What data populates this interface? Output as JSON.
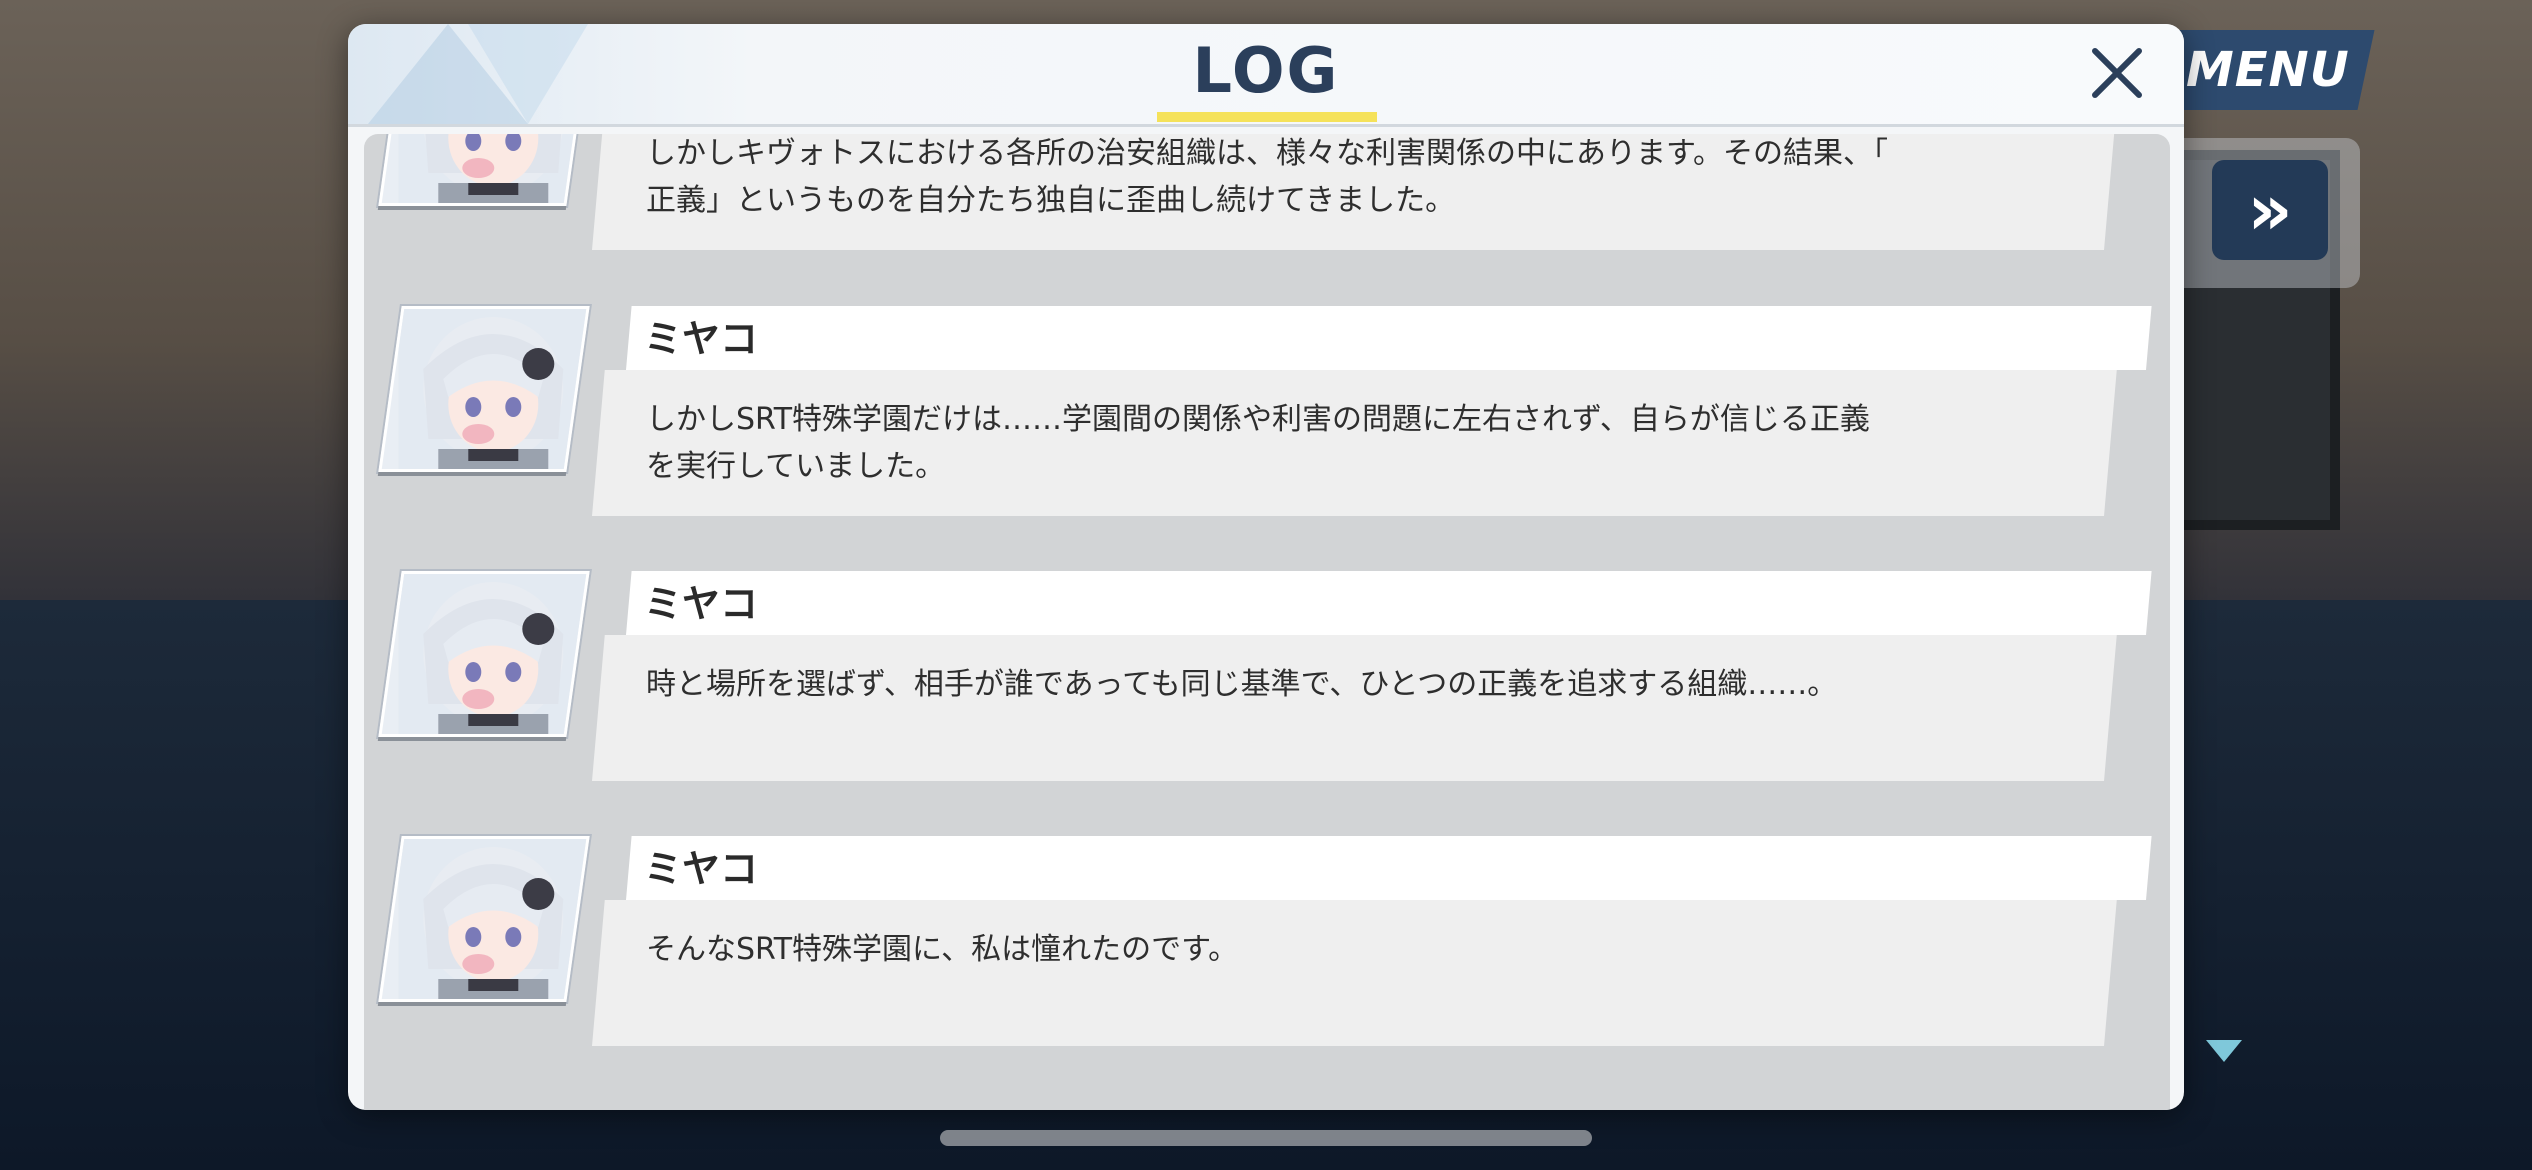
{
  "header": {
    "title": "LOG"
  },
  "hud": {
    "menu_label": "MENU",
    "fast_forward_icon": "double-chevron-right-icon"
  },
  "entries": [
    {
      "speaker": "",
      "lines": [
        "しかしキヴォトスにおける各所の治安組織は、様々な利害関係の中にあります。その結果、「",
        "正義」というものを自分たち独自に歪曲し続けてきました。"
      ]
    },
    {
      "speaker": "ミヤコ",
      "lines": [
        "しかしSRT特殊学園だけは……学園間の関係や利害の問題に左右されず、自らが信じる正義",
        "を実行していました。"
      ]
    },
    {
      "speaker": "ミヤコ",
      "lines": [
        "時と場所を選ばず、相手が誰であっても同じ基準で、ひとつの正義を追求する組織……。"
      ]
    },
    {
      "speaker": "ミヤコ",
      "lines": [
        "そんなSRT特殊学園に、私は憧れたのです。"
      ]
    }
  ],
  "colors": {
    "title": "#2b3f5b",
    "title_underline": "#f5e25a",
    "menu_bg": "#2d4a6e",
    "message_bg": "#efefef",
    "name_bar_bg": "#ffffff",
    "list_bg": "#d2d4d6"
  }
}
